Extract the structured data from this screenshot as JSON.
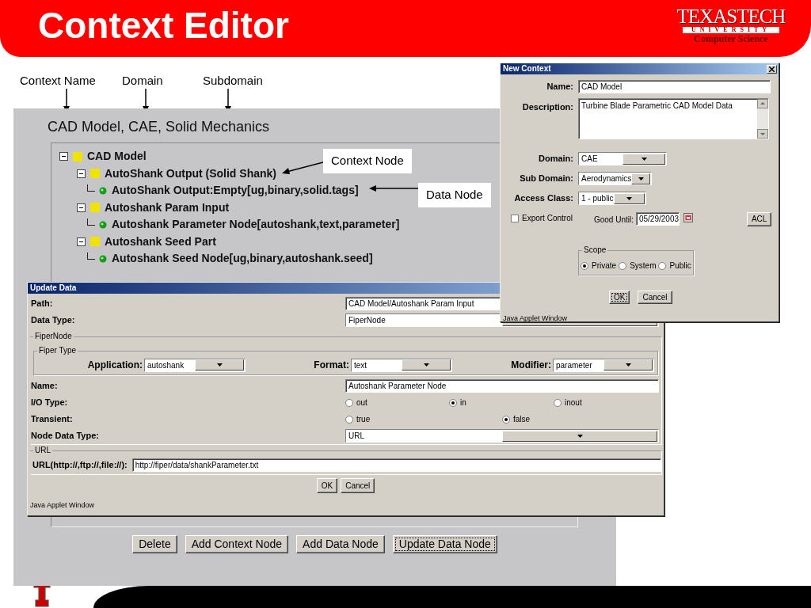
{
  "slide": {
    "title": "Context Editor",
    "logo": {
      "wordmark": "TEXASTECH",
      "subline": "UNIVERSITY",
      "department": "Computer Science"
    }
  },
  "annotations": {
    "field_labels": [
      "Context Name",
      "Domain",
      "Subdomain"
    ],
    "callouts": [
      "Context Node",
      "Data Node"
    ]
  },
  "context_editor": {
    "heading": "CAD Model, CAE, Solid Mechanics",
    "tree": [
      {
        "label": "CAD Model",
        "kind": "context",
        "expanded": true,
        "children": [
          {
            "label": "AutoShank Output (Solid Shank)",
            "kind": "context",
            "expanded": true,
            "children": [
              {
                "label": "AutoShank Output:Empty[ug,binary,solid.tags]",
                "kind": "data"
              }
            ]
          },
          {
            "label": "Autoshank Param Input",
            "kind": "context",
            "expanded": true,
            "children": [
              {
                "label": "Autoshank Parameter Node[autoshank,text,parameter]",
                "kind": "data"
              }
            ]
          },
          {
            "label": "Autoshank Seed Part",
            "kind": "context",
            "expanded": true,
            "children": [
              {
                "label": "Autoshank Seed Node[ug,binary,autoshank.seed]",
                "kind": "data"
              }
            ]
          }
        ]
      }
    ],
    "buttons": [
      {
        "label": "Delete",
        "focused": false
      },
      {
        "label": "Add Context Node",
        "focused": false
      },
      {
        "label": "Add Data Node",
        "focused": false
      },
      {
        "label": "Update Data Node",
        "focused": true
      }
    ]
  },
  "new_context": {
    "title": "New Context",
    "fields": [
      {
        "label": "Name:",
        "kind": "text",
        "value": "CAD Model"
      },
      {
        "label": "Description:",
        "kind": "textarea",
        "value": "Turbine Blade Parametric CAD Model Data"
      },
      {
        "label": "Domain:",
        "kind": "select",
        "value": "CAE"
      },
      {
        "label": "Sub Domain:",
        "kind": "select",
        "value": "Aerodynamics"
      },
      {
        "label": "Access Class:",
        "kind": "select",
        "value": "1 - public"
      }
    ],
    "export_control": {
      "label": "Export Control",
      "checked": false
    },
    "good_until": {
      "label": "Good Until:",
      "value": "05/29/2003"
    },
    "acl_button": "ACL",
    "scope": {
      "legend": "Scope",
      "options": [
        {
          "label": "Private",
          "selected": true
        },
        {
          "label": "System",
          "selected": false
        },
        {
          "label": "Public",
          "selected": false
        }
      ]
    },
    "buttons": [
      {
        "label": "OK",
        "focused": true
      },
      {
        "label": "Cancel",
        "focused": false
      }
    ],
    "status_bar": "Java Applet Window"
  },
  "update_data": {
    "title": "Update Data",
    "path": {
      "label": "Path:",
      "value": "CAD Model/Autoshank Param Input"
    },
    "data_type": {
      "label": "Data Type:",
      "value": "FiperNode"
    },
    "fiper_node": {
      "legend": "FiperNode",
      "fiper_type": {
        "legend": "Fiper Type",
        "selects": [
          {
            "label": "Application:",
            "value": "autoshank"
          },
          {
            "label": "Format:",
            "value": "text"
          },
          {
            "label": "Modifier:",
            "value": "parameter"
          }
        ]
      },
      "name": {
        "label": "Name:",
        "value": "Autoshank Parameter Node"
      },
      "io_type": {
        "label": "I/O Type:",
        "options": [
          {
            "label": "out",
            "selected": false
          },
          {
            "label": "in",
            "selected": true
          },
          {
            "label": "inout",
            "selected": false
          }
        ]
      },
      "transient": {
        "label": "Transient:",
        "options": [
          {
            "label": "true",
            "selected": false
          },
          {
            "label": "false",
            "selected": true
          }
        ]
      },
      "node_data_type": {
        "label": "Node Data Type:",
        "value": "URL"
      }
    },
    "url": {
      "legend": "URL",
      "label": "URL(http://,ftp://,file://):",
      "value": "http://fiper/data/shankParameter.txt"
    },
    "buttons": [
      {
        "label": "OK",
        "focused": false
      },
      {
        "label": "Cancel",
        "focused": false
      }
    ],
    "status_bar": "Java Applet Window"
  }
}
